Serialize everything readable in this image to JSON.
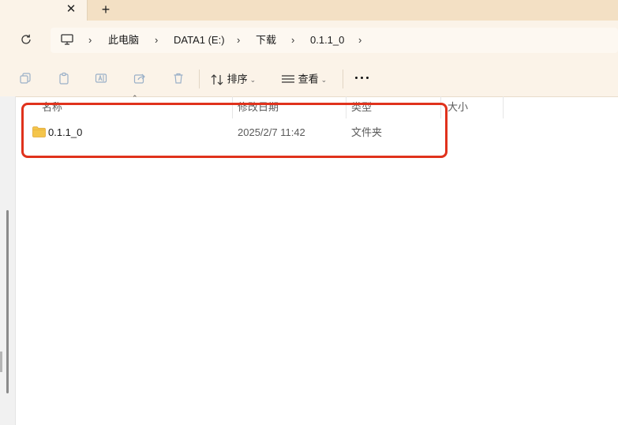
{
  "tabs": {
    "close_icon": "close-icon",
    "new_tab_icon": "plus-icon"
  },
  "address": {
    "breadcrumb": [
      "此电脑",
      "DATA1 (E:)",
      "下载",
      "0.1.1_0"
    ]
  },
  "commands": {
    "sort_label": "排序",
    "view_label": "查看",
    "icons": [
      "copy-icon",
      "paste-icon",
      "rename-icon",
      "share-icon",
      "delete-icon"
    ]
  },
  "columns": {
    "name": "名称",
    "modified": "修改日期",
    "type": "类型",
    "size": "大小"
  },
  "rows": [
    {
      "name": "0.1.1_0",
      "modified": "2025/2/7 11:42",
      "type": "文件夹",
      "size": ""
    }
  ],
  "colors": {
    "highlight": "#e0321c",
    "tab_strip": "#f3e0c4",
    "toolbar": "#fbf3e8",
    "folder": "#f4c54b"
  }
}
